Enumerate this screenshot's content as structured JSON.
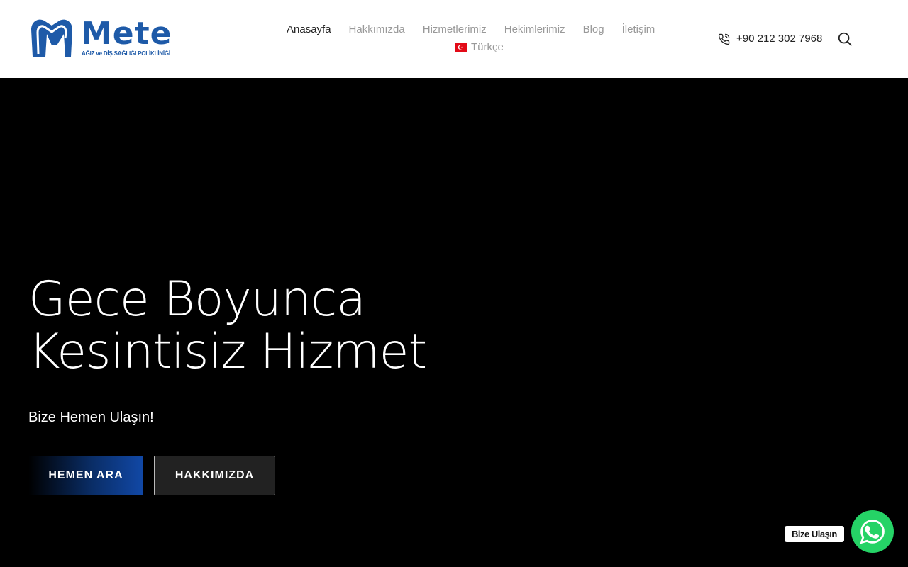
{
  "logo": {
    "name": "Mete",
    "subtitle": "AĞIZ ve DİŞ SAĞLIĞI POLİKLİNİĞİ"
  },
  "nav": {
    "items": [
      {
        "label": "Anasayfa",
        "active": true
      },
      {
        "label": "Hakkımızda",
        "active": false
      },
      {
        "label": "Hizmetlerimiz",
        "active": false
      },
      {
        "label": "Hekimlerimiz",
        "active": false
      },
      {
        "label": "Blog",
        "active": false
      },
      {
        "label": "İletişim",
        "active": false
      }
    ],
    "language": "Türkçe"
  },
  "header": {
    "phone": "+90 212 302 7968"
  },
  "hero": {
    "title_line1": "Gece Boyunca",
    "title_line2": "Kesintisiz Hizmet",
    "subtitle": "Bize Hemen Ulaşın!",
    "primary_button": "HEMEN ARA",
    "secondary_button": "HAKKIMIZDA"
  },
  "chat": {
    "label": "Bize Ulaşın"
  },
  "colors": {
    "brand_blue": "#1e5aa8",
    "whatsapp_green": "#25d366",
    "hero_background": "#000000"
  }
}
